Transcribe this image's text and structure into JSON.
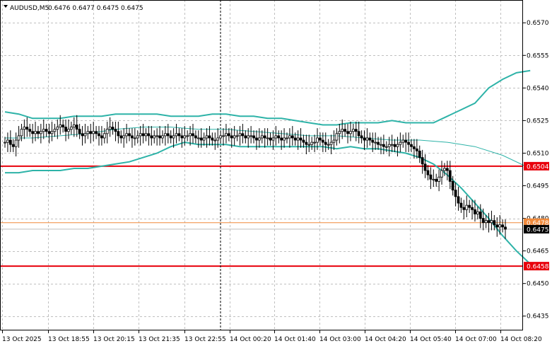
{
  "chart_data": {
    "type": "candlestick",
    "header": {
      "symbol_label": "AUDUSD,M5",
      "ohlc_text": "0.6476 0.6477 0.6475 0.6475"
    },
    "y_ticks": [
      "0.6570",
      "0.6555",
      "0.6540",
      "0.6525",
      "0.6510",
      "0.6495",
      "0.6480",
      "0.6465",
      "0.6450",
      "0.6435"
    ],
    "y_tick_values": [
      0.657,
      0.6555,
      0.654,
      0.6525,
      0.651,
      0.6495,
      0.648,
      0.6465,
      0.645,
      0.6435
    ],
    "ylim": [
      0.64284,
      0.65805
    ],
    "x_ticks": [
      "13 Oct 2025",
      "13 Oct 18:55",
      "13 Oct 20:15",
      "13 Oct 21:35",
      "13 Oct 22:55",
      "14 Oct 00:20",
      "14 Oct 01:40",
      "14 Oct 03:00",
      "14 Oct 04:20",
      "14 Oct 05:40",
      "14 Oct 07:00",
      "14 Oct 08:20"
    ],
    "horizontal_levels": [
      {
        "value": 0.6504,
        "label": "0.6504",
        "color": "#e8000b"
      },
      {
        "value": 0.6478,
        "label": "0.6478",
        "color": "#f08a3c"
      },
      {
        "value": 0.6458,
        "label": "0.6458",
        "color": "#e8000b"
      }
    ],
    "current_price": {
      "value": 0.6475,
      "label": "0.6475",
      "color": "#bdbdbd"
    },
    "colors": {
      "bollinger": "#2eb3a8",
      "candle": "#000000",
      "grid": "#c0c0c0",
      "background": "#ffffff"
    },
    "bollinger_upper": [
      [
        0,
        0.6529
      ],
      [
        5,
        0.6528
      ],
      [
        10,
        0.6526
      ],
      [
        15,
        0.6526
      ],
      [
        20,
        0.6526
      ],
      [
        25,
        0.6527
      ],
      [
        30,
        0.6527
      ],
      [
        35,
        0.6527
      ],
      [
        40,
        0.6528
      ],
      [
        45,
        0.6528
      ],
      [
        50,
        0.6528
      ],
      [
        55,
        0.6528
      ],
      [
        60,
        0.6527
      ],
      [
        65,
        0.6527
      ],
      [
        70,
        0.6527
      ],
      [
        75,
        0.6528
      ],
      [
        80,
        0.6528
      ],
      [
        85,
        0.6527
      ],
      [
        90,
        0.6527
      ],
      [
        95,
        0.6526
      ],
      [
        100,
        0.6526
      ],
      [
        105,
        0.6525
      ],
      [
        110,
        0.6524
      ],
      [
        115,
        0.6523
      ],
      [
        120,
        0.6523
      ],
      [
        125,
        0.6524
      ],
      [
        130,
        0.6524
      ],
      [
        135,
        0.6524
      ],
      [
        140,
        0.6525
      ],
      [
        145,
        0.6524
      ],
      [
        150,
        0.6524
      ],
      [
        155,
        0.6524
      ],
      [
        160,
        0.6527
      ],
      [
        165,
        0.653
      ],
      [
        170,
        0.6533
      ],
      [
        175,
        0.654
      ],
      [
        180,
        0.6544
      ],
      [
        185,
        0.6547
      ],
      [
        190,
        0.6548
      ]
    ],
    "bollinger_middle": [
      [
        0,
        0.6517
      ],
      [
        10,
        0.6517
      ],
      [
        20,
        0.6518
      ],
      [
        30,
        0.6519
      ],
      [
        40,
        0.6521
      ],
      [
        50,
        0.6522
      ],
      [
        60,
        0.6522
      ],
      [
        70,
        0.6521
      ],
      [
        80,
        0.6521
      ],
      [
        90,
        0.652
      ],
      [
        100,
        0.6519
      ],
      [
        110,
        0.6518
      ],
      [
        120,
        0.6518
      ],
      [
        130,
        0.6517
      ],
      [
        140,
        0.6516
      ],
      [
        150,
        0.6516
      ],
      [
        160,
        0.6515
      ],
      [
        170,
        0.6513
      ],
      [
        180,
        0.6509
      ],
      [
        190,
        0.6503
      ]
    ],
    "bollinger_lower": [
      [
        0,
        0.6501
      ],
      [
        5,
        0.6501
      ],
      [
        10,
        0.6502
      ],
      [
        15,
        0.6502
      ],
      [
        20,
        0.6502
      ],
      [
        25,
        0.6503
      ],
      [
        30,
        0.6503
      ],
      [
        35,
        0.6504
      ],
      [
        40,
        0.6505
      ],
      [
        45,
        0.6506
      ],
      [
        50,
        0.6508
      ],
      [
        55,
        0.651
      ],
      [
        60,
        0.6513
      ],
      [
        65,
        0.6515
      ],
      [
        70,
        0.6514
      ],
      [
        75,
        0.6514
      ],
      [
        80,
        0.6514
      ],
      [
        85,
        0.6513
      ],
      [
        90,
        0.6513
      ],
      [
        95,
        0.6513
      ],
      [
        100,
        0.6513
      ],
      [
        105,
        0.6513
      ],
      [
        110,
        0.6513
      ],
      [
        115,
        0.6513
      ],
      [
        120,
        0.6512
      ],
      [
        125,
        0.6513
      ],
      [
        130,
        0.6512
      ],
      [
        135,
        0.6512
      ],
      [
        140,
        0.6511
      ],
      [
        145,
        0.651
      ],
      [
        150,
        0.6508
      ],
      [
        155,
        0.6505
      ],
      [
        160,
        0.65
      ],
      [
        165,
        0.6494
      ],
      [
        170,
        0.6487
      ],
      [
        175,
        0.648
      ],
      [
        180,
        0.6472
      ],
      [
        185,
        0.6465
      ],
      [
        190,
        0.6459
      ]
    ],
    "closes": [
      0.6515,
      0.6516,
      0.6514,
      0.6513,
      0.6516,
      0.6518,
      0.6521,
      0.6522,
      0.6521,
      0.652,
      0.6519,
      0.652,
      0.6519,
      0.652,
      0.6521,
      0.652,
      0.6519,
      0.652,
      0.6521,
      0.6522,
      0.6523,
      0.6522,
      0.652,
      0.6521,
      0.6522,
      0.6523,
      0.6521,
      0.6519,
      0.6518,
      0.6519,
      0.652,
      0.6519,
      0.652,
      0.6519,
      0.6518,
      0.6517,
      0.6519,
      0.6521,
      0.6522,
      0.6521,
      0.652,
      0.6518,
      0.6517,
      0.6518,
      0.6519,
      0.6518,
      0.6517,
      0.6517,
      0.6518,
      0.6519,
      0.6518,
      0.6519,
      0.6518,
      0.6517,
      0.6518,
      0.6518,
      0.6517,
      0.6518,
      0.6519,
      0.6518,
      0.6517,
      0.6518,
      0.6519,
      0.6518,
      0.6517,
      0.6518,
      0.6518,
      0.6519,
      0.6518,
      0.6517,
      0.6517,
      0.6516,
      0.6517,
      0.6518,
      0.6517,
      0.6516,
      0.6516,
      0.6517,
      0.6518,
      0.6518,
      0.6519,
      0.6518,
      0.6517,
      0.6518,
      0.6518,
      0.6519,
      0.6518,
      0.6517,
      0.6518,
      0.6518,
      0.6517,
      0.6516,
      0.6517,
      0.6518,
      0.6517,
      0.6517,
      0.6516,
      0.6517,
      0.6518,
      0.6517,
      0.6516,
      0.6517,
      0.6517,
      0.6518,
      0.6517,
      0.6516,
      0.6517,
      0.6516,
      0.6515,
      0.6514,
      0.6514,
      0.6515,
      0.6515,
      0.6517,
      0.6516,
      0.6515,
      0.6514,
      0.6514,
      0.6515,
      0.6516,
      0.6519,
      0.652,
      0.6521,
      0.652,
      0.6519,
      0.652,
      0.6521,
      0.652,
      0.6518,
      0.6517,
      0.6516,
      0.6517,
      0.6516,
      0.6515,
      0.6515,
      0.6514,
      0.6514,
      0.6513,
      0.6513,
      0.6514,
      0.6514,
      0.6513,
      0.6514,
      0.6515,
      0.6516,
      0.6515,
      0.6514,
      0.6513,
      0.6512,
      0.6511,
      0.6508,
      0.6505,
      0.6502,
      0.65,
      0.6498,
      0.6498,
      0.6497,
      0.6499,
      0.6502,
      0.6503,
      0.6502,
      0.6497,
      0.6493,
      0.649,
      0.6487,
      0.6485,
      0.6484,
      0.6486,
      0.6485,
      0.6484,
      0.6482,
      0.6483,
      0.648,
      0.6478,
      0.6479,
      0.6478,
      0.6479,
      0.6477,
      0.6476,
      0.6477,
      0.6476,
      0.6475
    ]
  }
}
